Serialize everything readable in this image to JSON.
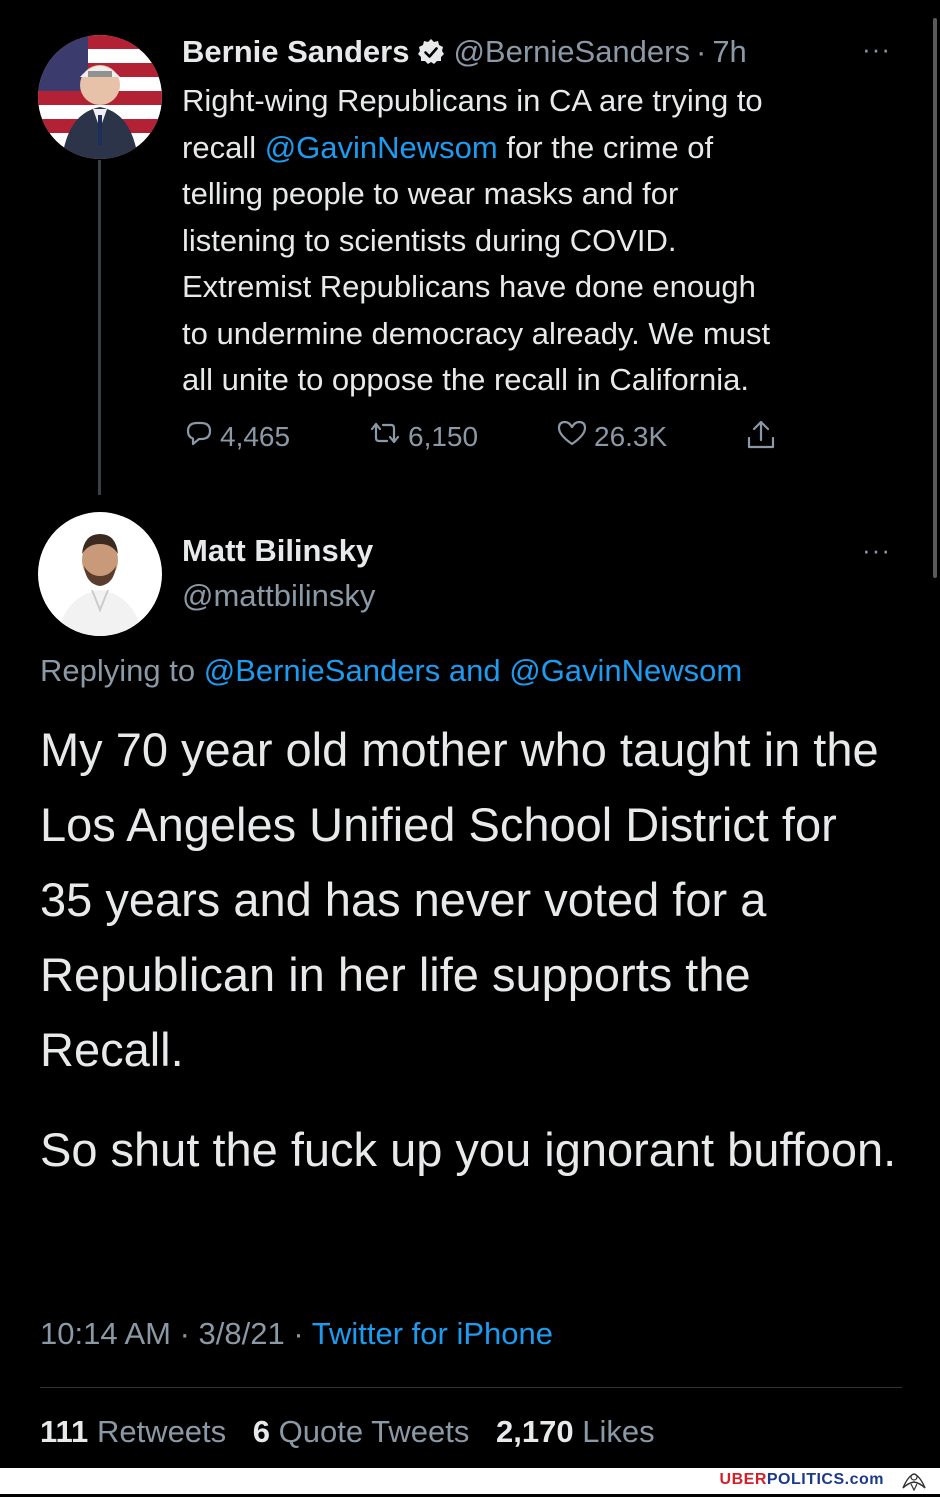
{
  "tweet1": {
    "name": "Bernie Sanders",
    "handle": "@BernieSanders",
    "separator": "·",
    "time": "7h",
    "more": "···",
    "body_pre": "Right-wing Republicans in CA are trying to\nrecall ",
    "mention": "@GavinNewsom",
    "body_post": " for the crime of\ntelling people to wear masks and for\nlistening to scientists during COVID.\nExtremist Republicans have done enough\nto undermine democracy already. We must\nall unite to oppose the recall in California.",
    "replies": "4,465",
    "retweets": "6,150",
    "likes": "26.3K"
  },
  "tweet2": {
    "name": "Matt Bilinsky",
    "handle": "@mattbilinsky",
    "more": "···",
    "replying_prefix": "Replying to ",
    "replying_to_1": "@BernieSanders",
    "replying_and": " and ",
    "replying_to_2": "@GavinNewsom",
    "paragraph1": "My 70 year old mother who taught in the Los Angeles Unified School District for 35 years and has never voted for a Republican in her life supports the Recall.",
    "paragraph2": "So shut the fuck up you ignorant buffoon.",
    "time": "10:14 AM",
    "date": "3/8/21",
    "meta_sep": " · ",
    "source": "Twitter for iPhone",
    "retweet_count": "111",
    "retweet_label": "Retweets",
    "quote_count": "6",
    "quote_label": "Quote Tweets",
    "like_count": "2,170",
    "like_label": "Likes"
  },
  "watermark": {
    "part1": "UBER",
    "part2": "POLITICS.com"
  },
  "icons": [
    "verified-badge-icon",
    "more-dots-icon",
    "reply-icon",
    "retweet-icon",
    "like-icon",
    "share-icon",
    "eagle-logo-icon"
  ],
  "colors": {
    "background": "#000000",
    "text": "#e7e9ea",
    "muted": "#8b98a5",
    "link": "#1d9bf0",
    "watermark_red": "#d4202a",
    "watermark_blue": "#1b3a8c"
  }
}
